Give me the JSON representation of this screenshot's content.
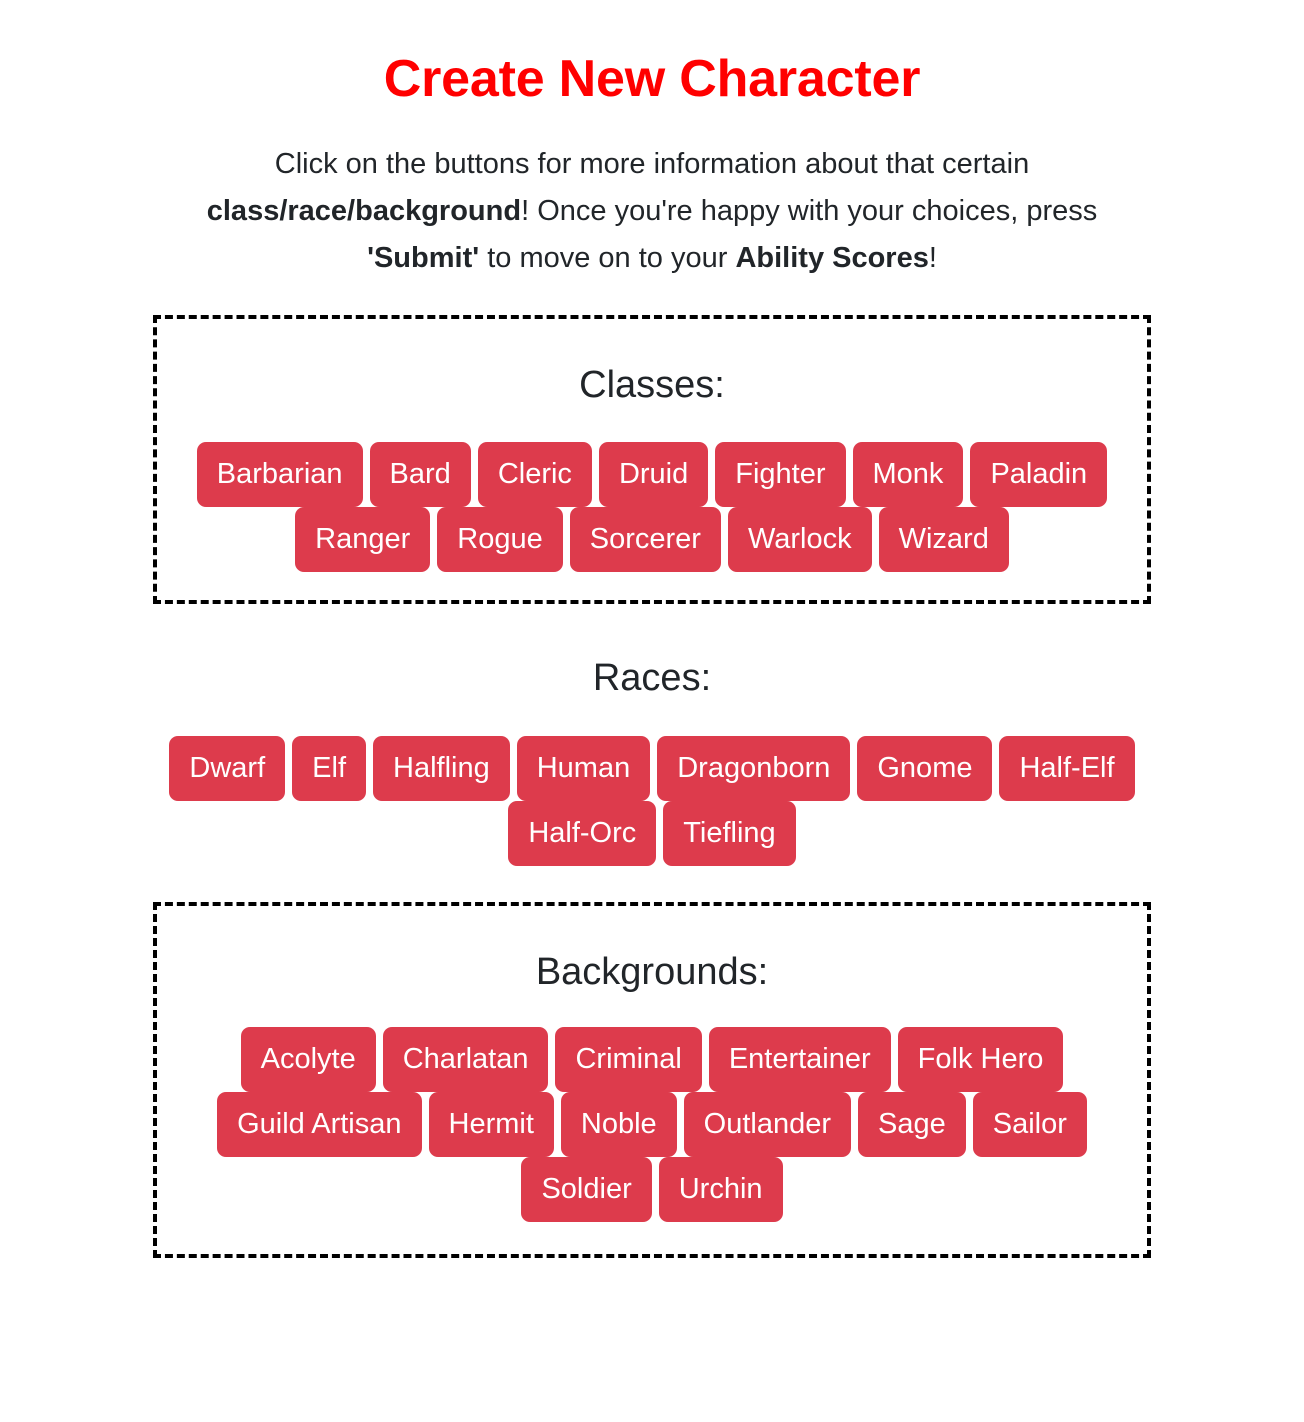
{
  "header": {
    "title": "Create New Character",
    "subtitle_parts": [
      {
        "text": "Click on the buttons for more information about that certain ",
        "bold": false
      },
      {
        "text": "class/race/background",
        "bold": true
      },
      {
        "text": "! Once you're happy with your choices, press ",
        "bold": false
      },
      {
        "text": "'Submit'",
        "bold": true
      },
      {
        "text": " to move on to your ",
        "bold": false
      },
      {
        "text": "Ability Scores",
        "bold": true
      },
      {
        "text": "!",
        "bold": false
      }
    ]
  },
  "colors": {
    "title_red": "#ff0000",
    "button_red": "#dd3b4c",
    "button_text": "#ffffff",
    "heading_dark": "#212529",
    "border_dashed": "#000000",
    "page_background": "#ffffff"
  },
  "sections": [
    {
      "id": "classes",
      "heading": "Classes:",
      "boxed": true,
      "buttons": [
        "Barbarian",
        "Bard",
        "Cleric",
        "Druid",
        "Fighter",
        "Monk",
        "Paladin",
        "Ranger",
        "Rogue",
        "Sorcerer",
        "Warlock",
        "Wizard"
      ]
    },
    {
      "id": "races",
      "heading": "Races:",
      "boxed": false,
      "buttons": [
        "Dwarf",
        "Elf",
        "Halfling",
        "Human",
        "Dragonborn",
        "Gnome",
        "Half-Elf",
        "Half-Orc",
        "Tiefling"
      ]
    },
    {
      "id": "backgrounds",
      "heading": "Backgrounds:",
      "boxed": true,
      "buttons": [
        "Acolyte",
        "Charlatan",
        "Criminal",
        "Entertainer",
        "Folk Hero",
        "Guild Artisan",
        "Hermit",
        "Noble",
        "Outlander",
        "Sage",
        "Sailor",
        "Soldier",
        "Urchin"
      ]
    }
  ]
}
